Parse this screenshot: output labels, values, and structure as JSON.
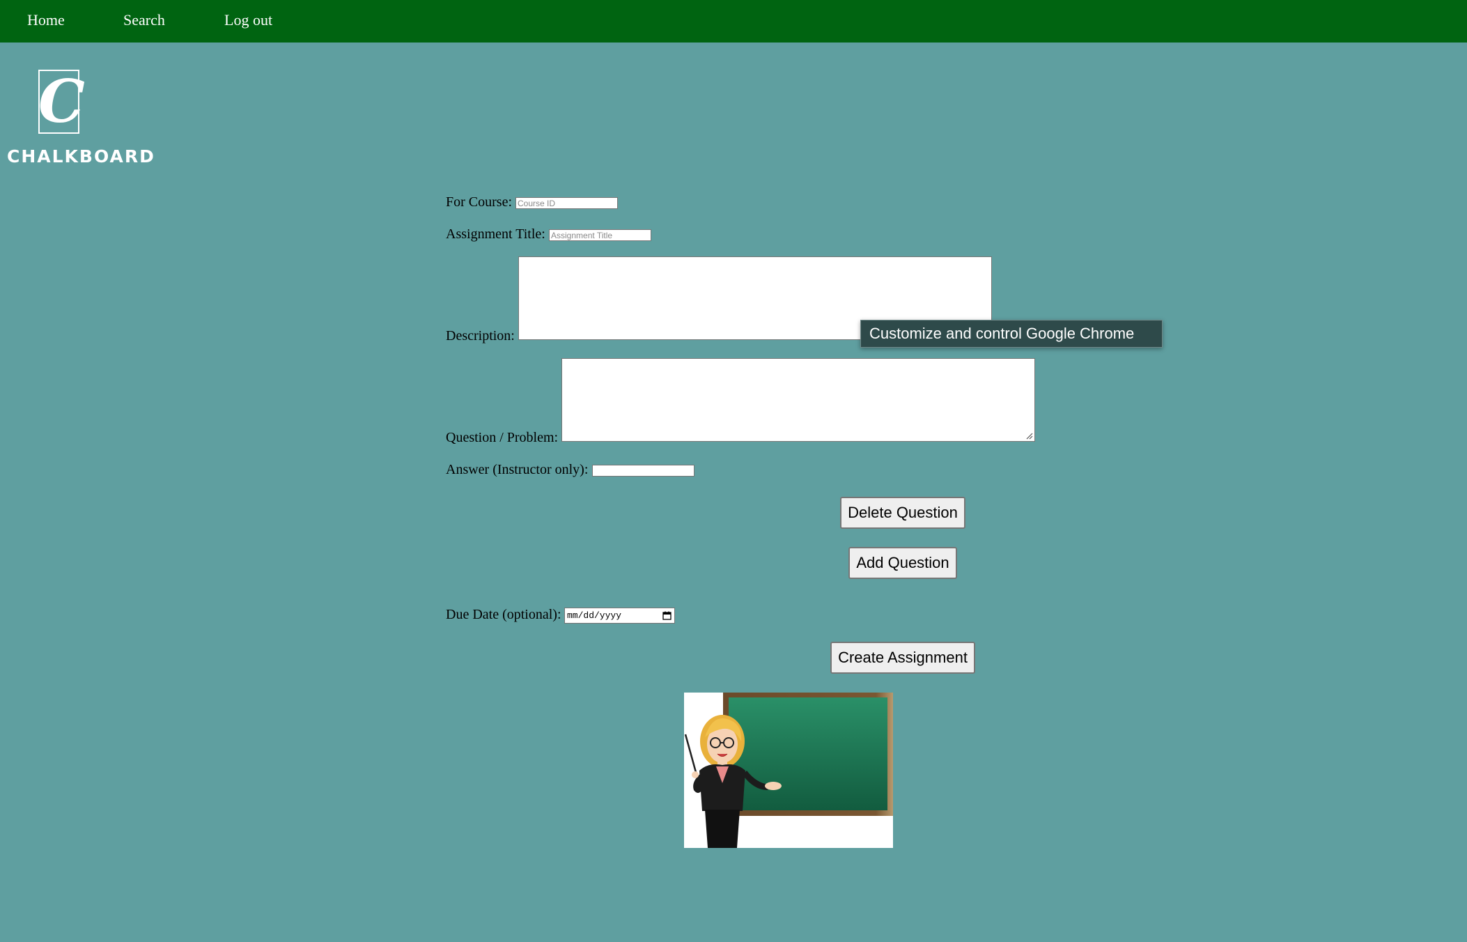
{
  "nav": {
    "items": [
      "Home",
      "Search",
      "Log out"
    ]
  },
  "logo": {
    "letter": "C",
    "word": "CHALKBOARD"
  },
  "form": {
    "course_label": "For Course:",
    "course_placeholder": "Course ID",
    "title_label": "Assignment Title:",
    "title_placeholder": "Assignment Title",
    "description_label": "Description:",
    "question_label": "Question / Problem:",
    "answer_label": "Answer (Instructor only):",
    "delete_question": "Delete Question",
    "add_question": "Add Question",
    "due_date_label": "Due Date (optional):",
    "due_date_placeholder": "mm/dd/yyyy",
    "create_assignment": "Create Assignment"
  },
  "tooltip": {
    "text": "Customize and control Google Chrome"
  },
  "colors": {
    "navbar": "#006411",
    "background": "#5f9fa0",
    "chalkboard": "#1f7a55"
  },
  "icons": {
    "calendar": "calendar-icon",
    "resize": "resize-grip-icon"
  }
}
